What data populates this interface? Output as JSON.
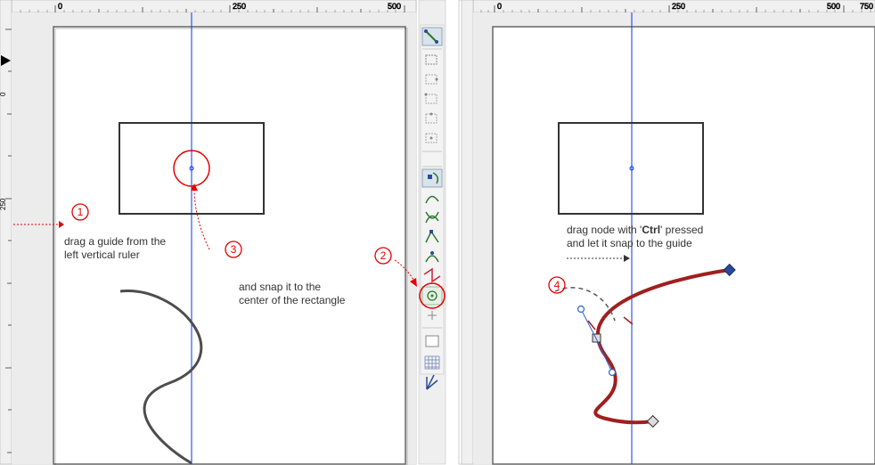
{
  "ruler_ticks": [
    "0",
    "250",
    "500",
    "750"
  ],
  "left": {
    "step1": {
      "num": "1",
      "text": [
        "drag a guide from the",
        "left vertical ruler"
      ]
    },
    "step2": {
      "num": "2",
      "text": [
        "and snap it to the",
        "center of the rectangle"
      ]
    },
    "step3": {
      "num": "3"
    }
  },
  "right": {
    "step4": {
      "num": "4",
      "text_parts": [
        "drag node with '",
        "Ctrl",
        "' pressed",
        "and let it snap to the guide"
      ]
    }
  },
  "snap_toolbar_buttons": [
    "snap-enabled",
    "snap-bbox",
    "snap-bbox-edge",
    "snap-bbox-corners",
    "snap-bbox-edge-mid",
    "snap-bbox-center",
    "snap-nodes",
    "snap-path",
    "snap-intersection",
    "snap-cusp",
    "snap-smooth",
    "snap-midpoint",
    "snap-object-center",
    "snap-rotation-center",
    "snap-text",
    "snap-page",
    "snap-grid",
    "snap-guides"
  ]
}
